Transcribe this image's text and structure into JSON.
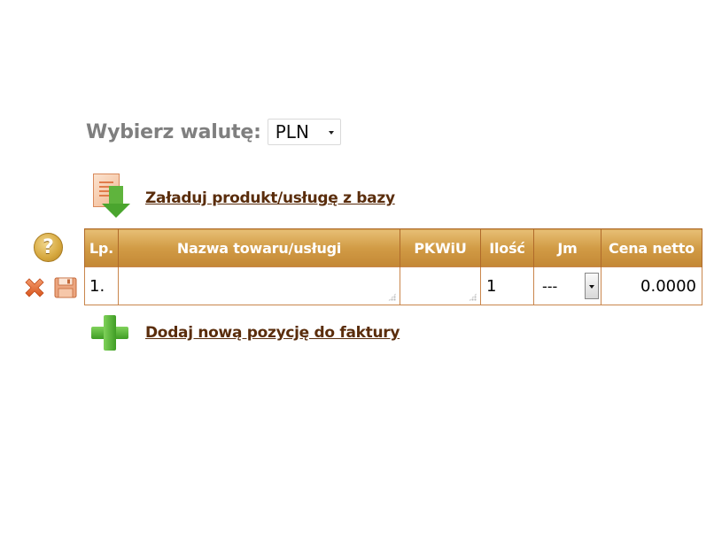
{
  "currency": {
    "label": "Wybierz walutę:",
    "selected": "PLN"
  },
  "load_link": {
    "label": "Załaduj produkt/usługę z bazy",
    "icon": "document-download-icon"
  },
  "help": {
    "symbol": "?"
  },
  "table": {
    "columns": [
      "Lp.",
      "Nazwa towaru/usługi",
      "PKWiU",
      "Ilość",
      "Jm",
      "Cena netto"
    ],
    "rows": [
      {
        "lp": "1.",
        "name": "",
        "pkwiu": "",
        "quantity": "1",
        "unit": "---",
        "net_price": "0.0000"
      }
    ]
  },
  "add_link": {
    "label": "Dodaj nową pozycję do faktury",
    "icon": "plus-icon"
  },
  "colors": {
    "header_gold": "#d19b45",
    "link_brown": "#5a2d0c",
    "border_orange": "#c9864c",
    "plus_green": "#4aa52e"
  }
}
